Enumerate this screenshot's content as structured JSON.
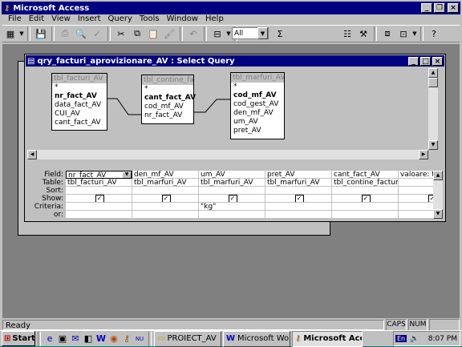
{
  "app": {
    "title": "Microsoft Access"
  },
  "menu": [
    "File",
    "Edit",
    "View",
    "Insert",
    "Query",
    "Tools",
    "Window",
    "Help"
  ],
  "toolbar": {
    "combo_value": "All"
  },
  "query_window": {
    "title": "qry_facturi_aprovizionare_AV : Select Query"
  },
  "tables": [
    {
      "name": "tbl_facturi_AV",
      "fields": [
        "*",
        "nr_fact_AV",
        "data_fact_AV",
        "CUI_AV",
        "cant_fact_AV"
      ],
      "bold": [
        "nr_fact_AV"
      ]
    },
    {
      "name": "tbl_contine_fact",
      "fields": [
        "*",
        "cant_fact_AV",
        "cod_mf_AV",
        "nr_fact_AV"
      ],
      "bold": [
        "cant_fact_AV"
      ]
    },
    {
      "name": "tbl_marfuri_AV",
      "fields": [
        "*",
        "cod_mf_AV",
        "cod_gest_AV",
        "den_mf_AV",
        "um_AV",
        "pret_AV"
      ],
      "bold": [
        "cod_mf_AV"
      ]
    }
  ],
  "grid": {
    "labels": [
      "Field:",
      "Table:",
      "Sort:",
      "Show:",
      "Criteria:",
      "or:"
    ],
    "columns": [
      {
        "field": "nr_fact_AV",
        "table": "tbl_facturi_AV",
        "criteria": ""
      },
      {
        "field": "den_mf_AV",
        "table": "tbl_marfuri_AV",
        "criteria": ""
      },
      {
        "field": "um_AV",
        "table": "tbl_marfuri_AV",
        "criteria": "\"kg\""
      },
      {
        "field": "pret_AV",
        "table": "tbl_marfuri_AV",
        "criteria": ""
      },
      {
        "field": "cant_fact_AV",
        "table": "tbl_contine_factura_",
        "criteria": ""
      },
      {
        "field": "valoare: tbl_f",
        "table": "",
        "criteria": ""
      }
    ]
  },
  "status": {
    "text": "Ready",
    "caps": "CAPS",
    "num": "NUM"
  },
  "taskbar": {
    "start": "Start",
    "tasks": [
      "PROIECT_AV",
      "Microsoft Word ...",
      "Microsoft Acc..."
    ],
    "lang": "En",
    "clock": "8:07 PM"
  },
  "colors": {
    "titlebar": "#000080",
    "desktop": "#008080",
    "face": "#c0c0c0"
  }
}
